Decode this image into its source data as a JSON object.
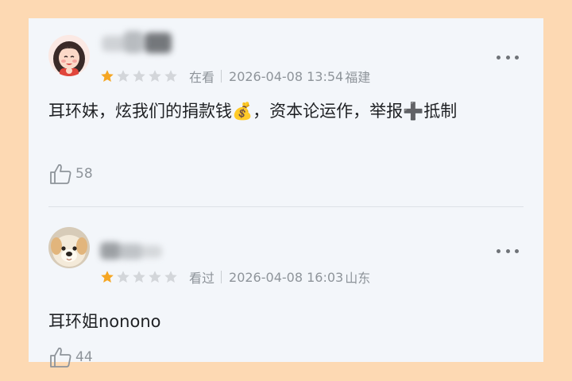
{
  "reviews": [
    {
      "rating": 1,
      "max_rating": 5,
      "status": "在看",
      "datetime": "2026-04-08 13:54",
      "location": "福建",
      "content": "耳环妹，炫我们的捐款钱💰，资本论运作，举报➕抵制",
      "likes": "58"
    },
    {
      "rating": 1,
      "max_rating": 5,
      "status": "看过",
      "datetime": "2026-04-08 16:03",
      "location": "山东",
      "content": "耳环姐nonono",
      "likes": "44"
    }
  ],
  "colors": {
    "star_filled": "#f5a623",
    "star_empty": "#d3d6da",
    "background": "#fdd9b3",
    "card": "#f3f6fa"
  },
  "icons": [
    "more-options-icon",
    "thumbs-up-icon",
    "star-icon"
  ]
}
